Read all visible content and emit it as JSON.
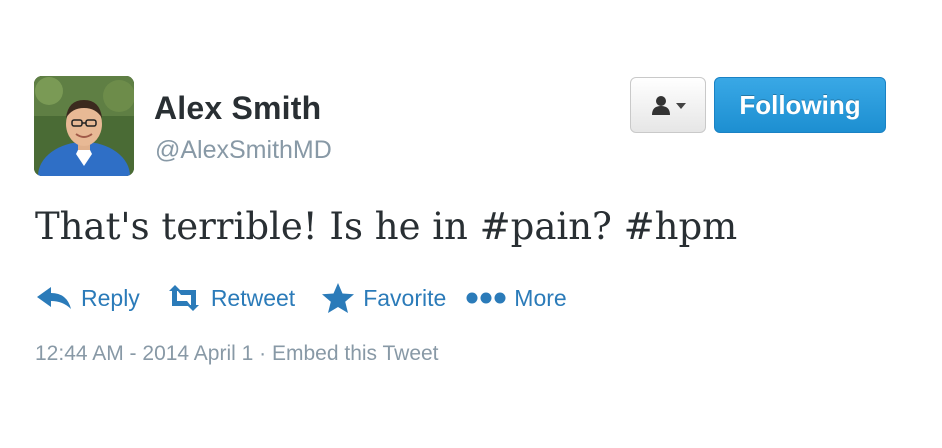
{
  "author": {
    "name": "Alex Smith",
    "handle": "@AlexSmithMD",
    "avatar_icon": "profile-photo"
  },
  "header_actions": {
    "user_menu_icon": "user-dropdown-icon",
    "follow_label": "Following"
  },
  "tweet": {
    "text": "That's terrible! Is he in #pain? #hpm"
  },
  "actions": [
    {
      "label": "Reply",
      "icon": "reply-icon"
    },
    {
      "label": "Retweet",
      "icon": "retweet-icon"
    },
    {
      "label": "Favorite",
      "icon": "star-icon"
    },
    {
      "label": "More",
      "icon": "more-dots-icon"
    }
  ],
  "meta": {
    "timestamp": "12:44 AM - 2014 April 1",
    "separator": "·",
    "embed_label": "Embed this Tweet"
  },
  "colors": {
    "link_blue": "#2b7bb9",
    "follow_blue": "#1d8fd1",
    "text_dark": "#292f33",
    "text_muted": "#8899a6"
  }
}
